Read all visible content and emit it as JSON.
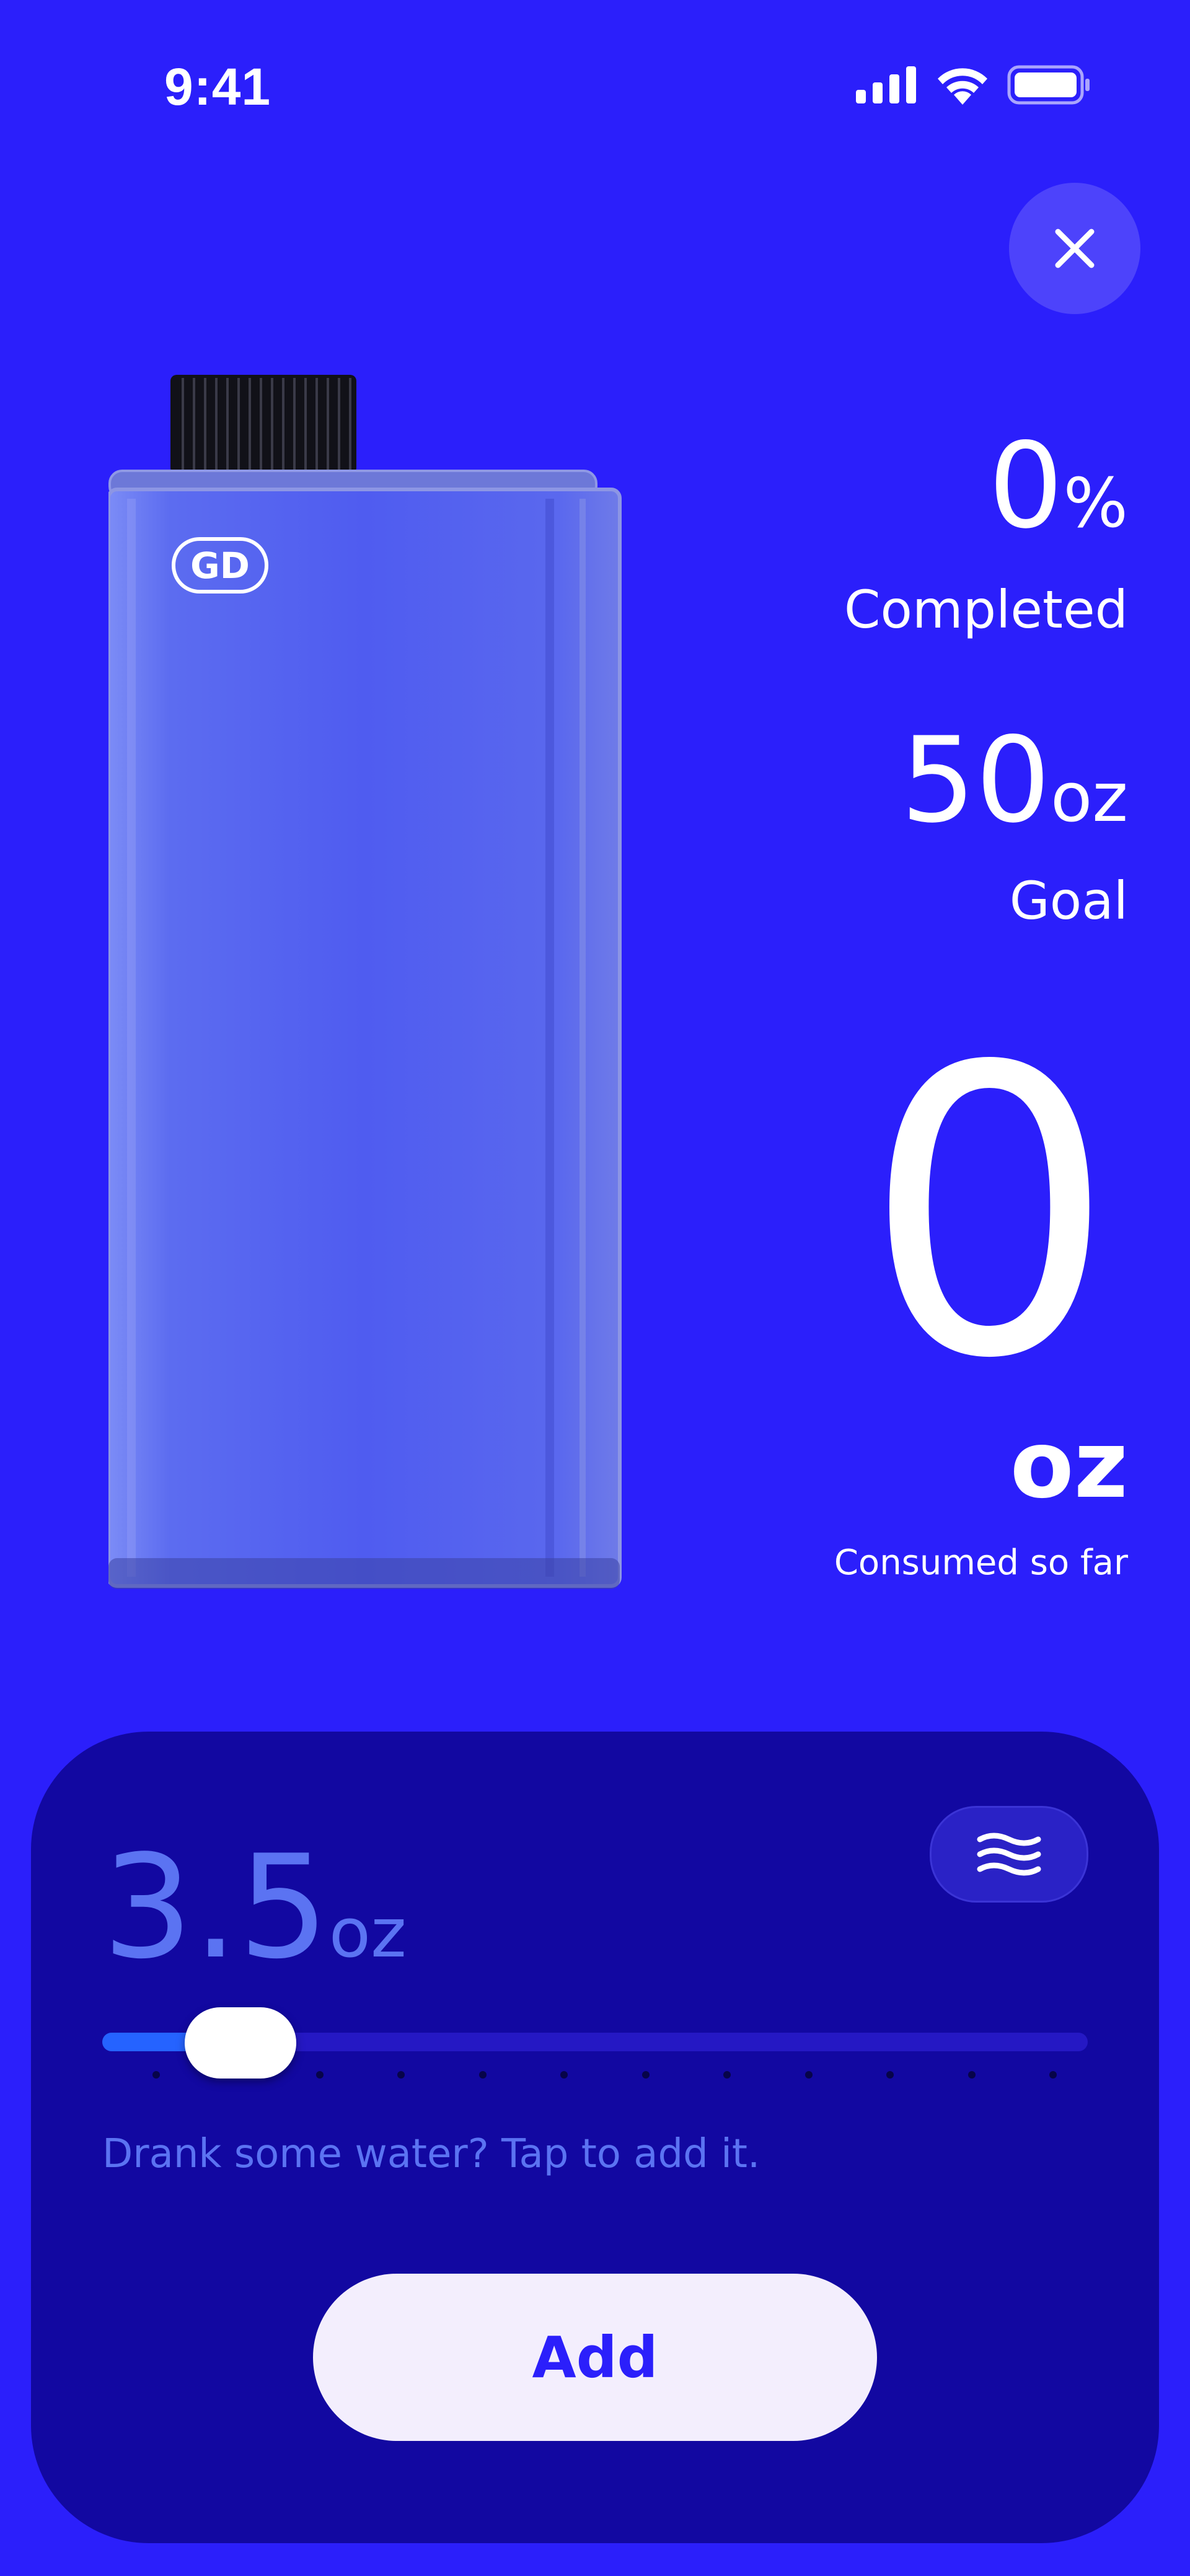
{
  "status_bar": {
    "time": "9:41"
  },
  "progress": {
    "percent_value": "0",
    "percent_unit": "%",
    "percent_label": "Completed"
  },
  "goal": {
    "value": "50",
    "unit": "oz",
    "label": "Goal"
  },
  "consumed": {
    "value": "0",
    "unit": "oz",
    "label": "Consumed so far"
  },
  "panel": {
    "amount_value": "3.5",
    "amount_unit": "oz",
    "slider_fraction": 0.14,
    "tick_count": 12,
    "hint": "Drank some water? Tap to add it.",
    "add_label": "Add"
  },
  "colors": {
    "background": "#2b1ffb",
    "panel": "#1208a1",
    "accent": "#5b73f2"
  },
  "icons": [
    "signal-icon",
    "wifi-icon",
    "battery-icon",
    "close-icon",
    "waves-icon"
  ]
}
